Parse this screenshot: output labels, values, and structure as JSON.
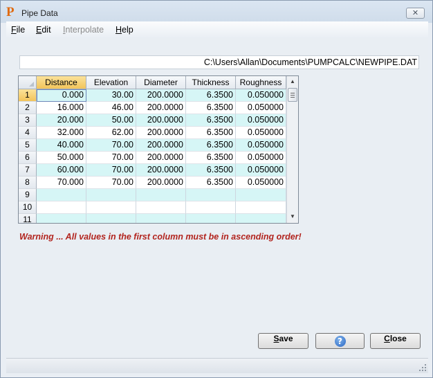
{
  "window": {
    "title": "Pipe Data",
    "icon": "P"
  },
  "menu": [
    {
      "label": "File",
      "key": "F",
      "rest": "ile",
      "enabled": true
    },
    {
      "label": "Edit",
      "key": "E",
      "rest": "dit",
      "enabled": true
    },
    {
      "label": "Interpolate",
      "key": "I",
      "rest": "nterpolate",
      "enabled": false
    },
    {
      "label": "Help",
      "key": "H",
      "rest": "elp",
      "enabled": true
    }
  ],
  "file_path": "C:\\Users\\Allan\\Documents\\PUMPCALC\\NEWPIPE.DAT",
  "grid": {
    "columns": [
      "Distance",
      "Elevation",
      "Diameter",
      "Thickness",
      "Roughness"
    ],
    "active_column": 0,
    "active_row": 0,
    "rows": [
      {
        "num": "1",
        "values": [
          "0.000",
          "30.00",
          "200.0000",
          "6.3500",
          "0.050000"
        ]
      },
      {
        "num": "2",
        "values": [
          "16.000",
          "46.00",
          "200.0000",
          "6.3500",
          "0.050000"
        ]
      },
      {
        "num": "3",
        "values": [
          "20.000",
          "50.00",
          "200.0000",
          "6.3500",
          "0.050000"
        ]
      },
      {
        "num": "4",
        "values": [
          "32.000",
          "62.00",
          "200.0000",
          "6.3500",
          "0.050000"
        ]
      },
      {
        "num": "5",
        "values": [
          "40.000",
          "70.00",
          "200.0000",
          "6.3500",
          "0.050000"
        ]
      },
      {
        "num": "6",
        "values": [
          "50.000",
          "70.00",
          "200.0000",
          "6.3500",
          "0.050000"
        ]
      },
      {
        "num": "7",
        "values": [
          "60.000",
          "70.00",
          "200.0000",
          "6.3500",
          "0.050000"
        ]
      },
      {
        "num": "8",
        "values": [
          "70.000",
          "70.00",
          "200.0000",
          "6.3500",
          "0.050000"
        ]
      },
      {
        "num": "9",
        "values": [
          "",
          "",
          "",
          "",
          ""
        ]
      },
      {
        "num": "10",
        "values": [
          "",
          "",
          "",
          "",
          ""
        ]
      },
      {
        "num": "11",
        "values": [
          "",
          "",
          "",
          "",
          ""
        ]
      }
    ]
  },
  "warning": "Warning ... All values in the first column must be in ascending order!",
  "buttons": {
    "save": {
      "key": "S",
      "rest": "ave"
    },
    "help": {
      "glyph": "?"
    },
    "close": {
      "key": "C",
      "rest": "lose"
    }
  },
  "colors": {
    "accent_alt_row": "#d6f6f6",
    "warning": "#b2241e",
    "active_header": "#f2c45a"
  }
}
